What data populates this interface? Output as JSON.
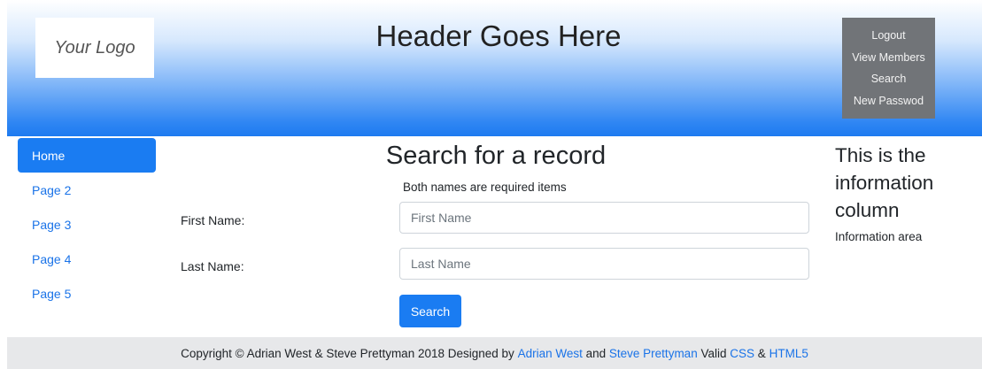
{
  "header": {
    "logo_text": "Your Logo",
    "title": "Header Goes Here",
    "nav": [
      {
        "label": "Logout"
      },
      {
        "label": "View Members"
      },
      {
        "label": "Search"
      },
      {
        "label": "New Passwod"
      }
    ]
  },
  "sidebar": {
    "items": [
      {
        "label": "Home",
        "active": true
      },
      {
        "label": "Page 2"
      },
      {
        "label": "Page 3"
      },
      {
        "label": "Page 4"
      },
      {
        "label": "Page 5"
      }
    ]
  },
  "main": {
    "heading": "Search for a record",
    "subtitle": "Both names are required items",
    "first_name": {
      "label": "First Name:",
      "placeholder": "First Name",
      "value": ""
    },
    "last_name": {
      "label": "Last Name:",
      "placeholder": "Last Name",
      "value": ""
    },
    "search_button": "Search"
  },
  "info": {
    "heading": "This is the information column",
    "text": "Information area"
  },
  "footer": {
    "copyright": "Copyright © Adrian West & Steve Prettyman 2018 Designed by",
    "link1": "Adrian West",
    "and1": "and",
    "link2": "Steve Prettyman",
    "valid": "Valid",
    "link3": "CSS",
    "amp": "&",
    "link4": "HTML5"
  },
  "colors": {
    "accent": "#1a7cf2",
    "link": "#1a73e8",
    "header_nav_bg": "#717478",
    "footer_bg": "#e7e8ea"
  }
}
